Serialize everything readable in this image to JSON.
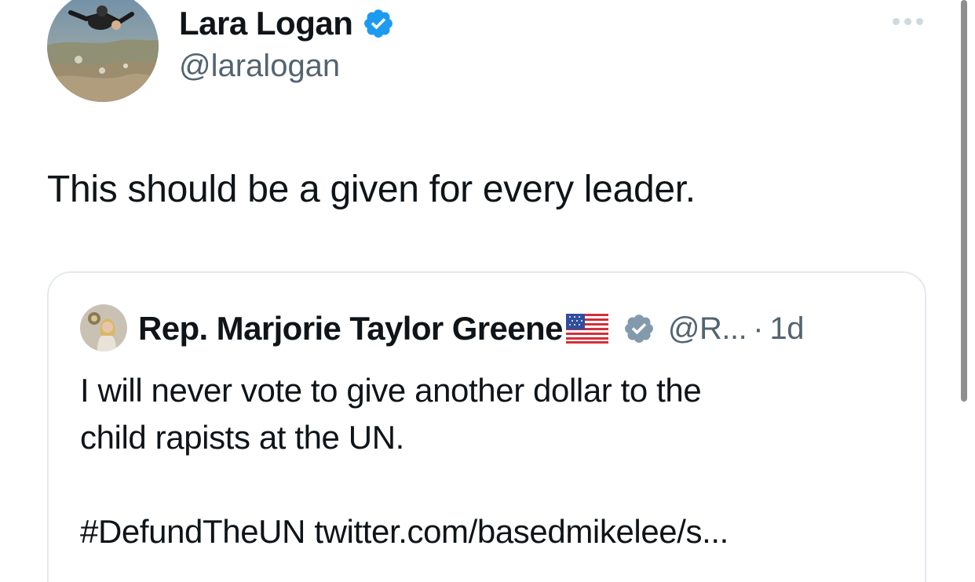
{
  "tweet": {
    "author": {
      "display_name": "Lara Logan",
      "handle": "@laralogan",
      "verified_color": "#1d9bf0"
    },
    "text": "This should be a given for every leader."
  },
  "quoted_tweet": {
    "author": {
      "display_name": "Rep. Marjorie Taylor Greene",
      "flag_icon": "us-flag-icon",
      "badge_color": "#829aab",
      "handle": "@R...",
      "separator": "·",
      "time": "1d"
    },
    "text_line_1": "I will never vote to give another dollar to the",
    "text_line_2": "child rapists at the UN.",
    "hashtag": "#DefundTheUN",
    "link": "twitter.com/basedmikelee/s..."
  },
  "icons": {
    "more": "more-horizontal-icon",
    "verified": "verified-badge-icon",
    "gov_verified": "gray-verified-badge-icon"
  }
}
